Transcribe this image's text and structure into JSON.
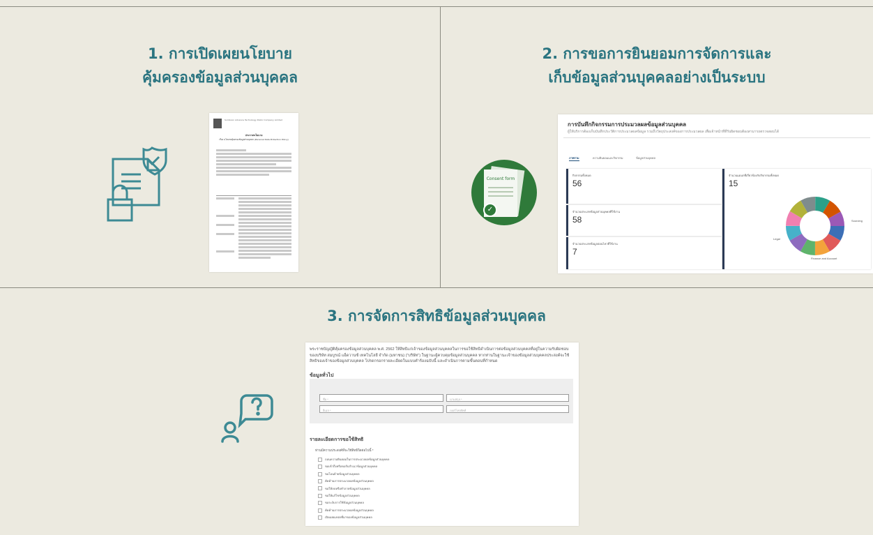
{
  "sections": [
    {
      "title_line1": "1. การเปิดเผยนโยบาย",
      "title_line2": "คุ้มครองข้อมูลส่วนบุคคล",
      "icon": "secure-document-lock-icon"
    },
    {
      "title_line1": "2. การขอการยินยอมการจัดการและ",
      "title_line2": "เก็บข้อมูลส่วนบุคคลอย่างเป็นระบบ",
      "icon": "consent-form-check-icon",
      "consent_label": "Consent form"
    },
    {
      "title": "3. การจัดการสิทธิข้อมูลส่วนบุคคล",
      "icon": "person-question-bubble-icon"
    }
  ],
  "dashboard": {
    "title": "การบันทึกกิจกรรมการประมวลผลข้อมูลส่วนบุคคล",
    "subtitle": "ผู้ให้บริการต้องเก็บบันทึกประวัติการประมวลผลข้อมูล รวมถึงวัตถุประสงค์ของการประมวลผล เพื่อเจ้าหน้าที่ที่รับผิดชอบต้องสามารถตรวจสอบได้",
    "tabs": [
      "ภาพรวม",
      "ความยินยอมและกิจกรรม",
      "ข้อมูลส่วนบุคคล"
    ],
    "cards": [
      {
        "label": "กิจกรรมทั้งหมด",
        "value": "56"
      },
      {
        "label": "จำนวนประเภทข้อมูลส่วนบุคคลที่ใช้งาน",
        "value": "58"
      },
      {
        "label": "จำนวนประเภทข้อมูลอ่อนไหวที่ใช้งาน",
        "value": "7"
      },
      {
        "label": "จำนวนแผนกที่เกี่ยวข้องกับกิจกรรมทั้งหมด",
        "value": "15"
      }
    ],
    "donut_labels": [
      "Finance and Account",
      "Legal",
      "Sourcing"
    ],
    "donut_colors": [
      "#3c6fb6",
      "#e05a5a",
      "#f3a33b",
      "#5fb36b",
      "#8e6bbf",
      "#46b1c9",
      "#f07fb0",
      "#b2b23a",
      "#7f8c8d",
      "#2ca089",
      "#d35400",
      "#9b59b6"
    ]
  },
  "form": {
    "intro": "พระราชบัญญัติคุ้มครองข้อมูลส่วนบุคคล พ.ศ. 2562 ให้สิทธิแก่เจ้าของข้อมูลส่วนบุคคลในการขอใช้สิทธิดำเนินการต่อข้อมูลส่วนบุคคลที่อยู่ในความรับผิดชอบของบริษัท สมบูรณ์ แอ็ดวานซ์ เทคโนโลยี จำกัด (มหาชน) (“บริษัท”) ในฐานะผู้ควบคุมข้อมูลส่วนบุคคล หากท่านในฐานะเจ้าของข้อมูลส่วนบุคคลประสงค์จะใช้สิทธิของเจ้าของข้อมูลส่วนบุคคล โปรดกรอกรายละเอียดในแบบคำร้องฉบับนี้ และดำเนินการตามขั้นตอนที่กำหนด",
    "general_heading": "ข้อมูลทั่วไป",
    "fields": [
      "ชื่อ *",
      "นามสกุล *",
      "อีเมล *",
      "เบอร์โทรศัพท์"
    ],
    "rights_heading": "รายละเอียดการขอใช้สิทธิ",
    "rights_question": "ท่านมีความประสงค์ที่จะใช้สิทธิใดต่อไปนี้ *",
    "options": [
      "ถอนความยินยอมในการประมวลผลข้อมูลส่วนบุคคล",
      "ขอเข้าถึงหรือขอรับสำเนาข้อมูลส่วนบุคคล",
      "ขอโอนย้ายข้อมูลส่วนบุคคล",
      "คัดค้านการประมวลผลข้อมูลส่วนบุคคล",
      "ขอให้ลบหรือทำลายข้อมูลส่วนบุคคล",
      "ขอให้แก้ไขข้อมูลส่วนบุคคล",
      "ขอระงับการใช้ข้อมูลส่วนบุคคล",
      "คัดค้านการประมวลผลข้อมูลส่วนบุคคล",
      "เปิดเผยแหล่งที่มาของข้อมูลส่วนบุคคล"
    ]
  },
  "policy_doc": {
    "company": "Somboon Advance Technology Public Company Limited",
    "heading": "ประกาศนโยบาย",
    "subheading": "เรื่อง นโยบายคุ้มครองข้อมูลส่วนบุคคล (Personal Data Protection Policy)"
  }
}
